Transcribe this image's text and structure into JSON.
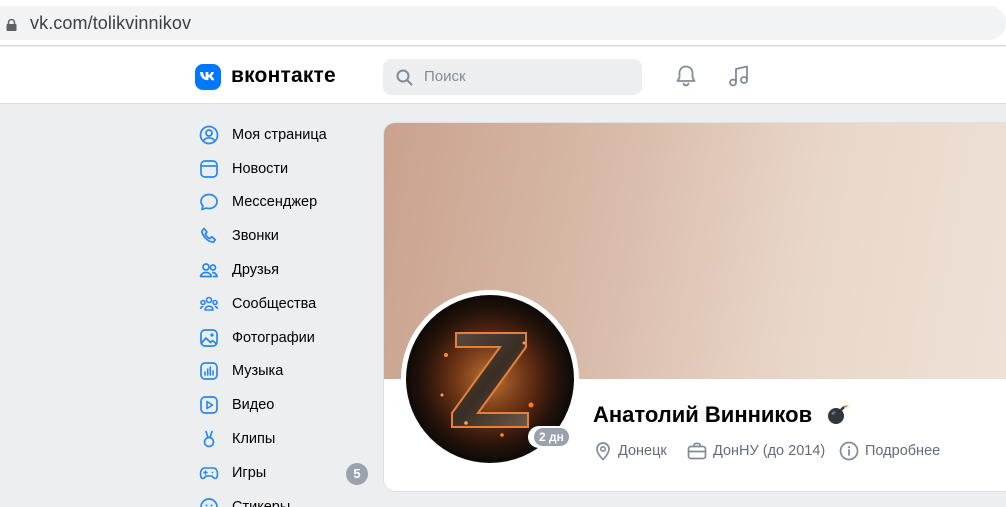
{
  "browser": {
    "url": "vk.com/tolikvinnikov"
  },
  "header": {
    "logo_text": "вконтакте",
    "search_placeholder": "Поиск",
    "brand_color": "#0077ff"
  },
  "menu": {
    "items": [
      {
        "label": "Моя страница",
        "icon": "user-circle-icon"
      },
      {
        "label": "Новости",
        "icon": "news-icon"
      },
      {
        "label": "Мессенджер",
        "icon": "message-icon"
      },
      {
        "label": "Звонки",
        "icon": "phone-icon"
      },
      {
        "label": "Друзья",
        "icon": "friends-icon"
      },
      {
        "label": "Сообщества",
        "icon": "communities-icon"
      },
      {
        "label": "Фотографии",
        "icon": "photo-icon"
      },
      {
        "label": "Музыка",
        "icon": "music-icon"
      },
      {
        "label": "Видео",
        "icon": "video-icon"
      },
      {
        "label": "Клипы",
        "icon": "clips-icon"
      },
      {
        "label": "Игры",
        "icon": "games-icon",
        "badge": "5"
      },
      {
        "label": "Стикеры",
        "icon": "stickers-icon"
      }
    ]
  },
  "profile": {
    "name": "Анатолий Винников",
    "last_seen": "2 дн",
    "city": "Донецк",
    "education": "ДонНУ (до 2014)",
    "details": "Подробнее"
  }
}
